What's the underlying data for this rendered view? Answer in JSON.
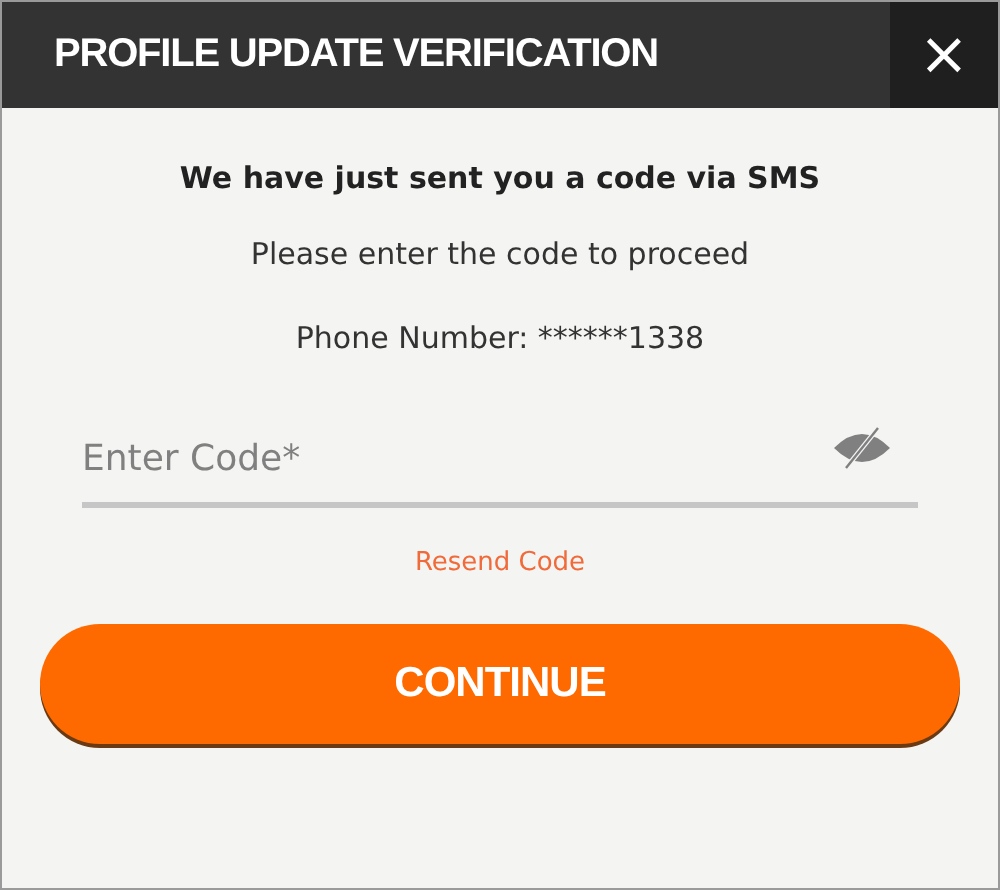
{
  "dialog": {
    "title": "PROFILE UPDATE VERIFICATION",
    "close": "×"
  },
  "message": {
    "heading": "We have just sent you a code via SMS",
    "instruction": "Please enter the code to proceed",
    "phone": "Phone Number: ******1338"
  },
  "code_field": {
    "placeholder": "Enter Code*",
    "masked": true
  },
  "resend_link": "Resend Code",
  "buttons": [
    "CONTINUE"
  ]
}
